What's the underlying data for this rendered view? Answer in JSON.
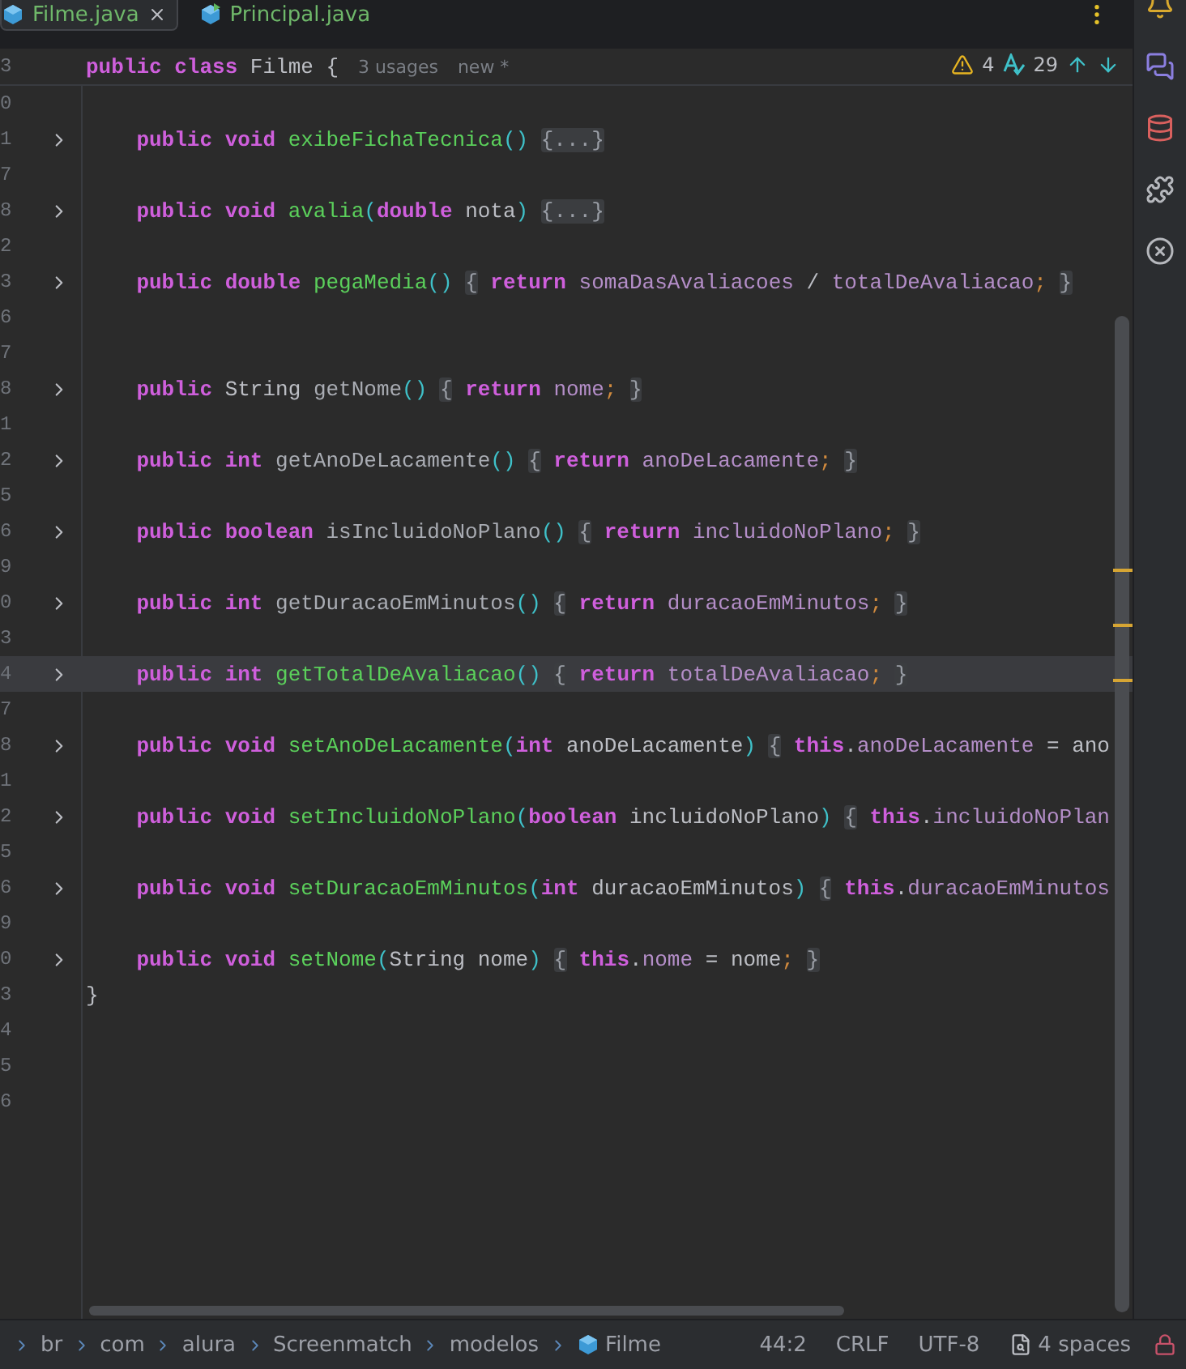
{
  "tabs": [
    {
      "label": "Filme.java",
      "selected": true,
      "closable": true,
      "run_badge": false
    },
    {
      "label": "Principal.java",
      "selected": false,
      "closable": false,
      "run_badge": true
    }
  ],
  "header": {
    "line_number": "3",
    "code": [
      {
        "text": "public class ",
        "kind": "keyword"
      },
      {
        "text": "Filme {",
        "kind": "plain"
      }
    ],
    "hints": [
      "3 usages",
      "new *"
    ]
  },
  "inspections": {
    "warnings": "4",
    "typos": "29"
  },
  "lines": [
    {
      "number": "0",
      "foldable": false,
      "current": false
    },
    {
      "number": "1",
      "foldable": true,
      "current": false,
      "code": [
        {
          "text": "    public void ",
          "kind": "keyword"
        },
        {
          "text": "exibeFichaTecnica",
          "kind": "method"
        },
        {
          "text": "() ",
          "kind": "paren"
        },
        {
          "text": "{...}",
          "kind": "fold"
        }
      ]
    },
    {
      "number": "7",
      "foldable": false,
      "current": false
    },
    {
      "number": "8",
      "foldable": true,
      "current": false,
      "code": [
        {
          "text": "    public void ",
          "kind": "keyword"
        },
        {
          "text": "avalia",
          "kind": "method"
        },
        {
          "text": "(",
          "kind": "paren"
        },
        {
          "text": "double",
          "kind": "keyword"
        },
        {
          "text": " nota",
          "kind": "plain"
        },
        {
          "text": ") ",
          "kind": "paren"
        },
        {
          "text": "{...}",
          "kind": "fold"
        }
      ]
    },
    {
      "number": "2",
      "foldable": false,
      "current": false
    },
    {
      "number": "3",
      "foldable": true,
      "current": false,
      "code": [
        {
          "text": "    public double ",
          "kind": "keyword"
        },
        {
          "text": "pegaMedia",
          "kind": "method"
        },
        {
          "text": "() ",
          "kind": "paren"
        },
        {
          "text": "{",
          "kind": "fold"
        },
        {
          "text": " return ",
          "kind": "keyword"
        },
        {
          "text": "somaDasAvaliacoes",
          "kind": "field"
        },
        {
          "text": " / ",
          "kind": "plain"
        },
        {
          "text": "totalDeAvaliacao",
          "kind": "field"
        },
        {
          "text": "; ",
          "kind": "semicolon"
        },
        {
          "text": "}",
          "kind": "fold"
        }
      ]
    },
    {
      "number": "6",
      "foldable": false,
      "current": false
    },
    {
      "number": "7",
      "foldable": false,
      "current": false
    },
    {
      "number": "8",
      "foldable": true,
      "current": false,
      "code": [
        {
          "text": "    public ",
          "kind": "keyword"
        },
        {
          "text": "String ",
          "kind": "plain"
        },
        {
          "text": "getNome",
          "kind": "reference"
        },
        {
          "text": "() ",
          "kind": "paren"
        },
        {
          "text": "{",
          "kind": "fold"
        },
        {
          "text": " return ",
          "kind": "keyword"
        },
        {
          "text": "nome",
          "kind": "field"
        },
        {
          "text": "; ",
          "kind": "semicolon"
        },
        {
          "text": "}",
          "kind": "fold"
        }
      ]
    },
    {
      "number": "1",
      "foldable": false,
      "current": false
    },
    {
      "number": "2",
      "foldable": true,
      "current": false,
      "code": [
        {
          "text": "    public int ",
          "kind": "keyword"
        },
        {
          "text": "getAnoDeLacamente",
          "kind": "reference"
        },
        {
          "text": "() ",
          "kind": "paren"
        },
        {
          "text": "{",
          "kind": "fold"
        },
        {
          "text": " return ",
          "kind": "keyword"
        },
        {
          "text": "anoDeLacamente",
          "kind": "field"
        },
        {
          "text": "; ",
          "kind": "semicolon"
        },
        {
          "text": "}",
          "kind": "fold"
        }
      ]
    },
    {
      "number": "5",
      "foldable": false,
      "current": false
    },
    {
      "number": "6",
      "foldable": true,
      "current": false,
      "code": [
        {
          "text": "    public boolean ",
          "kind": "keyword"
        },
        {
          "text": "isIncluidoNoPlano",
          "kind": "reference"
        },
        {
          "text": "() ",
          "kind": "paren"
        },
        {
          "text": "{",
          "kind": "fold"
        },
        {
          "text": " return ",
          "kind": "keyword"
        },
        {
          "text": "incluidoNoPlano",
          "kind": "field"
        },
        {
          "text": "; ",
          "kind": "semicolon"
        },
        {
          "text": "}",
          "kind": "fold"
        }
      ]
    },
    {
      "number": "9",
      "foldable": false,
      "current": false
    },
    {
      "number": "0",
      "foldable": true,
      "current": false,
      "code": [
        {
          "text": "    public int ",
          "kind": "keyword"
        },
        {
          "text": "getDuracaoEmMinutos",
          "kind": "reference"
        },
        {
          "text": "() ",
          "kind": "paren"
        },
        {
          "text": "{",
          "kind": "fold"
        },
        {
          "text": " return ",
          "kind": "keyword"
        },
        {
          "text": "duracaoEmMinutos",
          "kind": "field"
        },
        {
          "text": "; ",
          "kind": "semicolon"
        },
        {
          "text": "}",
          "kind": "fold"
        }
      ]
    },
    {
      "number": "3",
      "foldable": false,
      "current": false
    },
    {
      "number": "4",
      "foldable": true,
      "current": true,
      "code": [
        {
          "text": "    public int ",
          "kind": "keyword"
        },
        {
          "text": "getTotalDeAvaliacao",
          "kind": "method"
        },
        {
          "text": "() ",
          "kind": "paren"
        },
        {
          "text": "{",
          "kind": "fold"
        },
        {
          "text": " return ",
          "kind": "keyword"
        },
        {
          "text": "totalDeAvaliacao",
          "kind": "field"
        },
        {
          "text": "; ",
          "kind": "semicolon"
        },
        {
          "text": "}",
          "kind": "fold"
        }
      ]
    },
    {
      "number": "7",
      "foldable": false,
      "current": false
    },
    {
      "number": "8",
      "foldable": true,
      "current": false,
      "code": [
        {
          "text": "    public void ",
          "kind": "keyword"
        },
        {
          "text": "setAnoDeLacamente",
          "kind": "method"
        },
        {
          "text": "(",
          "kind": "paren"
        },
        {
          "text": "int",
          "kind": "keyword"
        },
        {
          "text": " anoDeLacamente",
          "kind": "plain"
        },
        {
          "text": ") ",
          "kind": "paren"
        },
        {
          "text": "{",
          "kind": "fold"
        },
        {
          "text": " this",
          "kind": "keyword"
        },
        {
          "text": ".",
          "kind": "plain"
        },
        {
          "text": "anoDeLacamente",
          "kind": "field"
        },
        {
          "text": " = ano",
          "kind": "plain"
        }
      ]
    },
    {
      "number": "1",
      "foldable": false,
      "current": false
    },
    {
      "number": "2",
      "foldable": true,
      "current": false,
      "code": [
        {
          "text": "    public void ",
          "kind": "keyword"
        },
        {
          "text": "setIncluidoNoPlano",
          "kind": "method"
        },
        {
          "text": "(",
          "kind": "paren"
        },
        {
          "text": "boolean",
          "kind": "keyword"
        },
        {
          "text": " incluidoNoPlano",
          "kind": "plain"
        },
        {
          "text": ") ",
          "kind": "paren"
        },
        {
          "text": "{",
          "kind": "fold"
        },
        {
          "text": " this",
          "kind": "keyword"
        },
        {
          "text": ".",
          "kind": "plain"
        },
        {
          "text": "incluidoNoPlan",
          "kind": "field"
        }
      ]
    },
    {
      "number": "5",
      "foldable": false,
      "current": false
    },
    {
      "number": "6",
      "foldable": true,
      "current": false,
      "code": [
        {
          "text": "    public void ",
          "kind": "keyword"
        },
        {
          "text": "setDuracaoEmMinutos",
          "kind": "method"
        },
        {
          "text": "(",
          "kind": "paren"
        },
        {
          "text": "int",
          "kind": "keyword"
        },
        {
          "text": " duracaoEmMinutos",
          "kind": "plain"
        },
        {
          "text": ") ",
          "kind": "paren"
        },
        {
          "text": "{",
          "kind": "fold"
        },
        {
          "text": " this",
          "kind": "keyword"
        },
        {
          "text": ".",
          "kind": "plain"
        },
        {
          "text": "duracaoEmMinutos",
          "kind": "field"
        }
      ]
    },
    {
      "number": "9",
      "foldable": false,
      "current": false
    },
    {
      "number": "0",
      "foldable": true,
      "current": false,
      "code": [
        {
          "text": "    public void ",
          "kind": "keyword"
        },
        {
          "text": "setNome",
          "kind": "method"
        },
        {
          "text": "(",
          "kind": "paren"
        },
        {
          "text": "String nome",
          "kind": "plain"
        },
        {
          "text": ") ",
          "kind": "paren"
        },
        {
          "text": "{",
          "kind": "fold"
        },
        {
          "text": " this",
          "kind": "keyword"
        },
        {
          "text": ".",
          "kind": "plain"
        },
        {
          "text": "nome",
          "kind": "field"
        },
        {
          "text": " = nome",
          "kind": "plain"
        },
        {
          "text": "; ",
          "kind": "semicolon"
        },
        {
          "text": "}",
          "kind": "fold"
        }
      ]
    },
    {
      "number": "3",
      "foldable": false,
      "current": false,
      "code": [
        {
          "text": "}",
          "kind": "plain"
        }
      ]
    },
    {
      "number": "4",
      "foldable": false,
      "current": false
    },
    {
      "number": "5",
      "foldable": false,
      "current": false
    },
    {
      "number": "6",
      "foldable": false,
      "current": false
    }
  ],
  "status_bar": {
    "breadcrumbs": [
      {
        "label": "br",
        "kind": "package"
      },
      {
        "label": "com",
        "kind": "package"
      },
      {
        "label": "alura",
        "kind": "package"
      },
      {
        "label": "Screenmatch",
        "kind": "package"
      },
      {
        "label": "modelos",
        "kind": "package"
      },
      {
        "label": "Filme",
        "kind": "class"
      }
    ],
    "position": "44:2",
    "line_separator": "CRLF",
    "encoding": "UTF-8",
    "indent": "4 spaces"
  }
}
